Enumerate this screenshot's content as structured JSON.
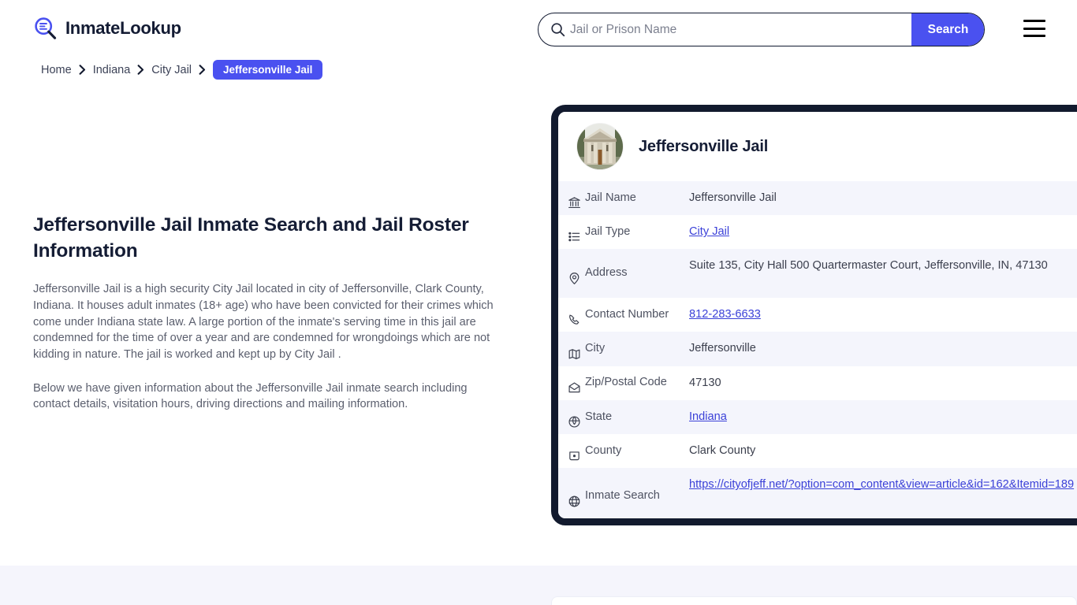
{
  "header": {
    "logo_text": "InmateLookup",
    "logo_icon": "magnifier-list-icon",
    "search": {
      "placeholder": "Jail or Prison Name",
      "value": "",
      "button_label": "Search",
      "icon": "search-icon"
    },
    "menu_icon": "hamburger-menu-icon",
    "accent_color": "#4a51f0"
  },
  "breadcrumb": {
    "items": [
      {
        "label": "Home"
      },
      {
        "label": "Indiana"
      },
      {
        "label": "City Jail"
      }
    ],
    "separator": "❯",
    "current": "Jeffersonville Jail"
  },
  "main": {
    "title": "Jeffersonville Jail Inmate Search and Jail Roster Information",
    "paragraph_1": "Jeffersonville Jail is a high security City Jail located in city of Jeffersonville, Clark County, Indiana. It houses adult inmates (18+ age) who have been convicted for their crimes which come under Indiana state law. A large portion of the inmate's serving time in this jail are condemned for the time of over a year and are condemned for wrongdoings which are not kidding in nature. The jail is worked and kept up by City Jail .",
    "paragraph_2": "Below we have given information about the Jeffersonville Jail inmate search including contact details, visitation hours, driving directions and mailing information."
  },
  "card": {
    "avatar_icon": "courthouse-building-photo",
    "title": "Jeffersonville Jail",
    "border_color": "#121a2e",
    "rows": [
      {
        "icon": "bank-building-icon",
        "label": "Jail Name",
        "value": "Jeffersonville Jail",
        "link": false
      },
      {
        "icon": "list-icon",
        "label": "Jail Type",
        "value": "City Jail",
        "link": true
      },
      {
        "icon": "map-pin-icon",
        "label": "Address",
        "value": "Suite 135, City Hall 500 Quartermaster Court, Jeffersonville, IN, 47130",
        "link": false
      },
      {
        "icon": "phone-icon",
        "label": "Contact Number",
        "value": "812-283-6633",
        "link": true
      },
      {
        "icon": "map-icon",
        "label": "City",
        "value": "Jeffersonville",
        "link": false
      },
      {
        "icon": "envelope-open-icon",
        "label": "Zip/Postal Code",
        "value": "47130",
        "link": false
      },
      {
        "icon": "shield-globe-icon",
        "label": "State",
        "value": "Indiana",
        "link": true
      },
      {
        "icon": "county-badge-icon",
        "label": "County",
        "value": "Clark County",
        "link": false
      },
      {
        "icon": "globe-icon",
        "label": "Inmate Search",
        "value": "https://cityofjeff.net/?option=com_content&view=article&id=162&Itemid=189",
        "link": true
      }
    ]
  }
}
